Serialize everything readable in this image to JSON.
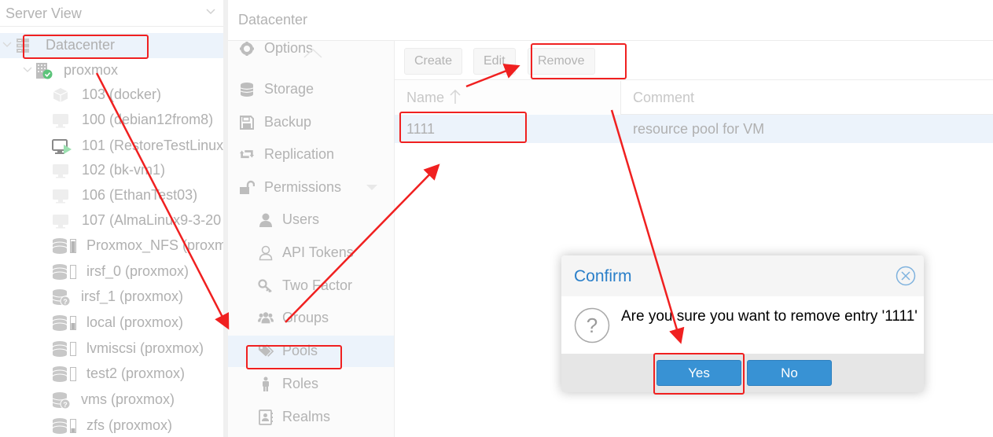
{
  "tree": {
    "view_label": "Server View",
    "items": [
      {
        "label": "Datacenter",
        "icon": "datacenter-icon",
        "level": 0,
        "selected": true
      },
      {
        "label": "proxmox",
        "icon": "node-online-icon",
        "level": 1
      },
      {
        "label": "103 (docker)",
        "icon": "container-icon",
        "level": 2
      },
      {
        "label": "100 (debian12from8)",
        "icon": "vm-stopped-icon",
        "level": 2
      },
      {
        "label": "101 (RestoreTestLinux",
        "icon": "vm-running-icon",
        "level": 2
      },
      {
        "label": "102 (bk-vm1)",
        "icon": "vm-stopped-icon",
        "level": 2
      },
      {
        "label": "106 (EthanTest03)",
        "icon": "vm-stopped-icon",
        "level": 2
      },
      {
        "label": "107 (AlmaLinux9-3-20",
        "icon": "vm-stopped-icon",
        "level": 2
      },
      {
        "label": "Proxmox_NFS (proxmox)",
        "icon": "storage-icon",
        "level": 2,
        "usage": 0.9
      },
      {
        "label": "irsf_0 (proxmox)",
        "icon": "storage-icon",
        "level": 2,
        "usage": 0.0
      },
      {
        "label": "irsf_1 (proxmox)",
        "icon": "storage-unknown-icon",
        "level": 2
      },
      {
        "label": "local (proxmox)",
        "icon": "storage-icon",
        "level": 2,
        "usage": 0.5
      },
      {
        "label": "lvmiscsi (proxmox)",
        "icon": "storage-icon",
        "level": 2,
        "usage": 0.0
      },
      {
        "label": "test2 (proxmox)",
        "icon": "storage-icon",
        "level": 2,
        "usage": 0.0
      },
      {
        "label": "vms (proxmox)",
        "icon": "storage-unknown-icon",
        "level": 2
      },
      {
        "label": "zfs (proxmox)",
        "icon": "storage-icon",
        "level": 2,
        "usage": 0.3
      }
    ]
  },
  "content": {
    "title": "Datacenter",
    "nav": [
      {
        "label": "Options",
        "icon": "gear-icon",
        "sub": false
      },
      {
        "label": "Storage",
        "icon": "database-icon",
        "sub": false
      },
      {
        "label": "Backup",
        "icon": "floppy-icon",
        "sub": false
      },
      {
        "label": "Replication",
        "icon": "retweet-icon",
        "sub": false
      },
      {
        "label": "Permissions",
        "icon": "unlock-icon",
        "sub": false,
        "expandable": true
      },
      {
        "label": "Users",
        "icon": "user-icon",
        "sub": true
      },
      {
        "label": "API Tokens",
        "icon": "user-outline-icon",
        "sub": true
      },
      {
        "label": "Two Factor",
        "icon": "key-icon",
        "sub": true
      },
      {
        "label": "Groups",
        "icon": "users-icon",
        "sub": true
      },
      {
        "label": "Pools",
        "icon": "tags-icon",
        "sub": true,
        "selected": true
      },
      {
        "label": "Roles",
        "icon": "male-icon",
        "sub": true
      },
      {
        "label": "Realms",
        "icon": "address-book-icon",
        "sub": true
      }
    ],
    "toolbar": {
      "create_label": "Create",
      "edit_label": "Edit",
      "remove_label": "Remove"
    },
    "grid": {
      "columns": [
        {
          "label": "Name",
          "sort": "asc"
        },
        {
          "label": "Comment"
        }
      ],
      "rows": [
        {
          "name": "1111",
          "comment": "resource pool for VM"
        }
      ]
    }
  },
  "dialog": {
    "title": "Confirm",
    "message": "Are you sure you want to remove entry '1111'",
    "yes_label": "Yes",
    "no_label": "No",
    "colors": {
      "title": "#2a7fc9",
      "button": "#3892d4"
    }
  },
  "annotations": {
    "color": "#f02020"
  }
}
